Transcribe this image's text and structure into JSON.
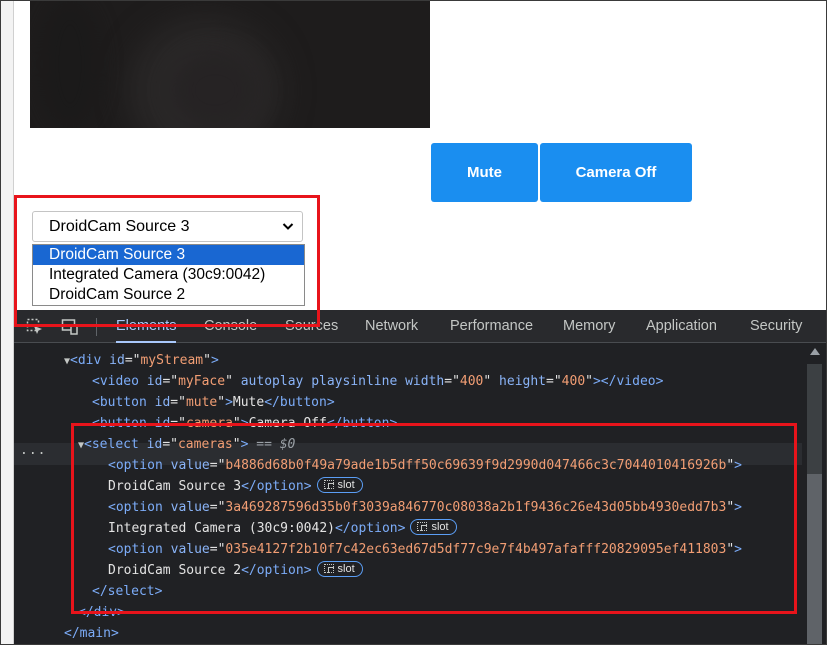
{
  "page": {
    "mute_label": "Mute",
    "camera_label": "Camera Off",
    "camera_select": {
      "selected": "DroidCam Source 3",
      "options": [
        "DroidCam Source 3",
        "Integrated Camera (30c9:0042)",
        "DroidCam Source 2"
      ]
    }
  },
  "devtools": {
    "tabs": [
      "Elements",
      "Console",
      "Sources",
      "Network",
      "Performance",
      "Memory",
      "Application",
      "Security"
    ],
    "active_tab": "Elements",
    "dom": {
      "div_tag": "div",
      "div_id_attr": "id",
      "div_id": "myStream",
      "video_tag": "video",
      "video_attrs": [
        {
          "name": "id",
          "value": "myFace"
        },
        {
          "name": "autoplay",
          "value": ""
        },
        {
          "name": "playsinline",
          "value": ""
        },
        {
          "name": "width",
          "value": "400"
        },
        {
          "name": "height",
          "value": "400"
        }
      ],
      "button_mute": {
        "tag": "button",
        "attr": "id",
        "id": "mute",
        "text": "Mute"
      },
      "button_camera": {
        "tag": "button",
        "attr": "id",
        "id": "camera",
        "text": "Camera Off"
      },
      "select": {
        "tag": "select",
        "attr": "id",
        "id": "cameras",
        "marker": "== $0"
      },
      "options": [
        {
          "tag": "option",
          "attr": "value",
          "value": "b4886d68b0f49a79ade1b5dff50c69639f9d2990d047466c3c7044010416926b",
          "text": "DroidCam Source 3"
        },
        {
          "tag": "option",
          "attr": "value",
          "value": "3a469287596d35b0f3039a846770c08038a2b1f9436c26e43d05bb4930edd7b3",
          "text": "Integrated Camera (30c9:0042)"
        },
        {
          "tag": "option",
          "attr": "value",
          "value": "035e4127f2b10f7c42ec63ed67d5df77c9e7f4b497afafff20829095ef411803",
          "text": "DroidCam Source 2"
        }
      ],
      "slot_label": "slot",
      "close_select": "select",
      "close_div": "div",
      "close_main": "main",
      "row_ellipsis": "..."
    }
  },
  "colors": {
    "button_blue": "#1a8ef0",
    "highlight_red": "#e8141b",
    "devtools_bg": "#202124",
    "selected_option": "#1967d2"
  }
}
